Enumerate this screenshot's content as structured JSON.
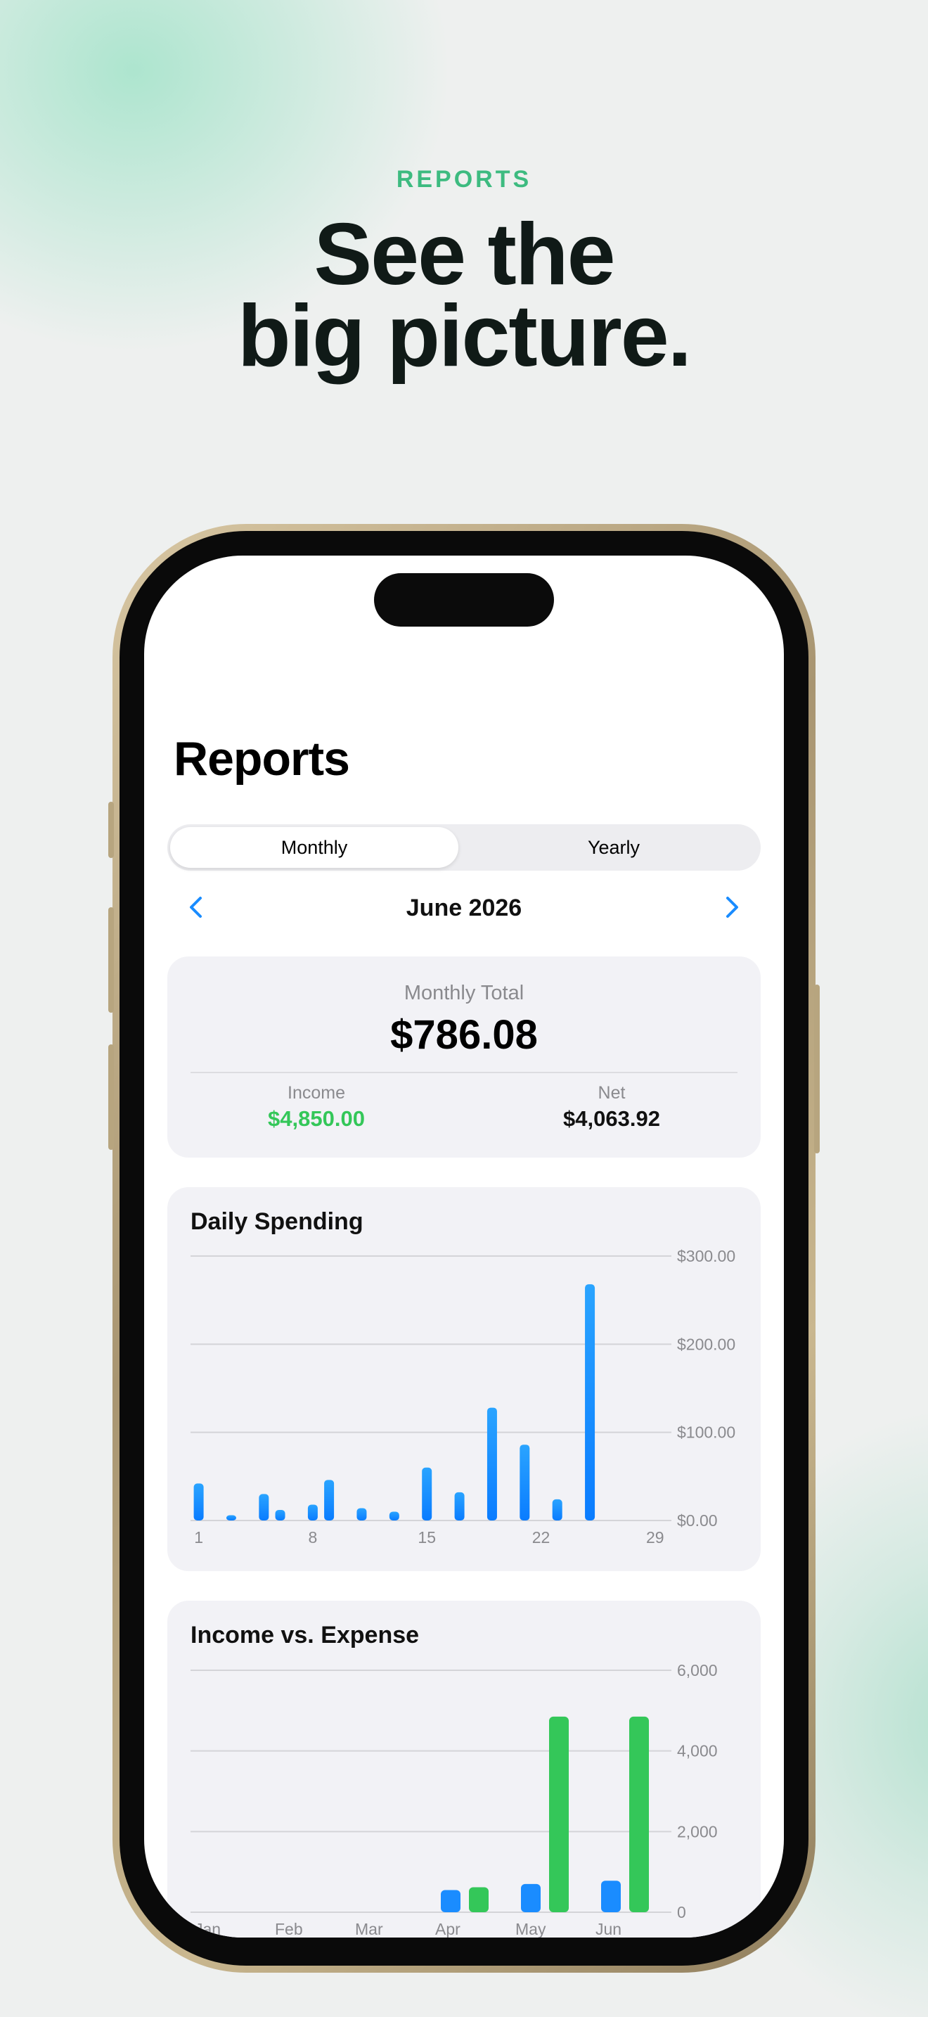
{
  "marketing": {
    "eyebrow": "REPORTS",
    "headline_line1": "See the",
    "headline_line2": "big picture."
  },
  "screen": {
    "title": "Reports",
    "segments": [
      "Monthly",
      "Yearly"
    ],
    "selected_segment": "Monthly",
    "period": "June 2026",
    "prev_icon": "chevron-left-icon",
    "next_icon": "chevron-right-icon",
    "accent_color": "#1a8cff",
    "summary": {
      "total_label": "Monthly Total",
      "total_value": "$786.08",
      "income_label": "Income",
      "income_value": "$4,850.00",
      "net_label": "Net",
      "net_value": "$4,063.92"
    }
  },
  "chart_data": [
    {
      "type": "bar",
      "title": "Daily Spending",
      "x": [
        1,
        3,
        5,
        6,
        8,
        9,
        11,
        13,
        15,
        17,
        19,
        21,
        23,
        25,
        26,
        28
      ],
      "values": [
        42,
        6,
        30,
        12,
        18,
        46,
        14,
        10,
        60,
        32,
        128,
        86,
        24,
        268,
        0,
        0
      ],
      "xticks": [
        "1",
        "8",
        "15",
        "22",
        "29"
      ],
      "xtick_positions": [
        1,
        8,
        15,
        22,
        29
      ],
      "yticks": [
        "$0.00",
        "$100.00",
        "$200.00",
        "$300.00"
      ],
      "ylim": [
        0,
        300
      ],
      "x_range": [
        0.5,
        30
      ],
      "color": "#1a8cff",
      "grid": true
    },
    {
      "type": "bar",
      "title": "Income vs. Expense",
      "categories": [
        "Jan",
        "Feb",
        "Mar",
        "Apr",
        "May",
        "Jun"
      ],
      "series": [
        {
          "values": [
            0,
            0,
            0,
            550,
            700,
            780
          ],
          "color": "#1a8cff"
        },
        {
          "values": [
            0,
            0,
            0,
            620,
            4850,
            4850
          ],
          "color": "#34c759"
        }
      ],
      "yticks": [
        "0",
        "2,000",
        "4,000",
        "6,000"
      ],
      "ylim": [
        0,
        6000
      ],
      "grid": true
    }
  ]
}
